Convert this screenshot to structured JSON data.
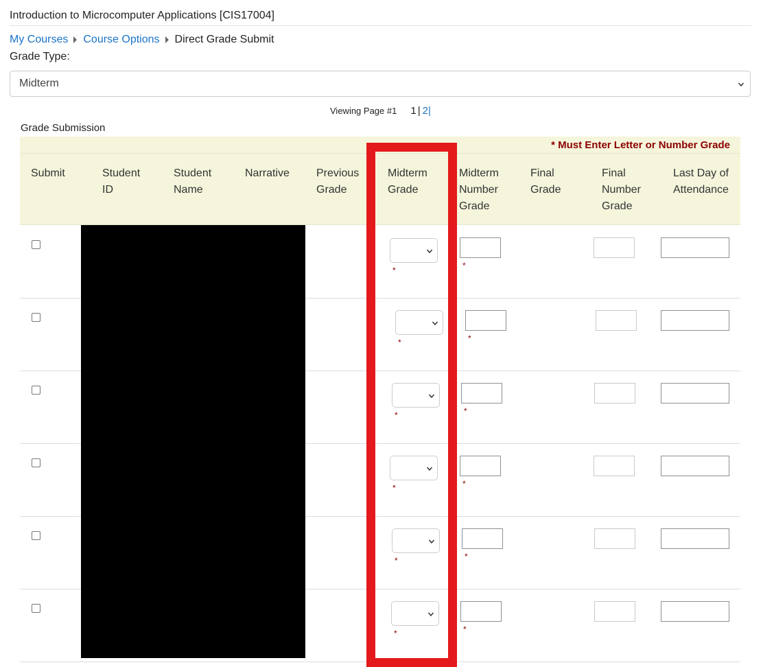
{
  "course_title": "Introduction to Microcomputer Applications [CIS17004]",
  "breadcrumb": {
    "items": [
      "My Courses",
      "Course Options"
    ],
    "current": "Direct Grade Submit"
  },
  "grade_type": {
    "label": "Grade Type:",
    "selected": "Midterm"
  },
  "pager": {
    "label": "Viewing Page #1",
    "current": "1",
    "separator": "|",
    "next": "2",
    "trail": "|"
  },
  "section_title": "Grade Submission",
  "required_note": "* Must Enter Letter or Number Grade",
  "columns": [
    [
      "Submit"
    ],
    [
      "Student",
      "ID"
    ],
    [
      "Student",
      "Name"
    ],
    [
      "Narrative"
    ],
    [
      "Previous",
      "Grade"
    ],
    [
      "Midterm",
      "Grade"
    ],
    [
      "Midterm",
      "Number",
      "Grade"
    ],
    [
      "Final",
      "Grade"
    ],
    [
      "Final",
      "Number",
      "Grade"
    ],
    [
      "Last Day of",
      "Attendance"
    ]
  ],
  "row_count": 6,
  "required_marker": "*",
  "colors": {
    "link": "#1a73c7",
    "header_bg": "#f5f5dc",
    "required": "#8b0000",
    "highlight": "#e4191b",
    "redaction": "#000000"
  }
}
